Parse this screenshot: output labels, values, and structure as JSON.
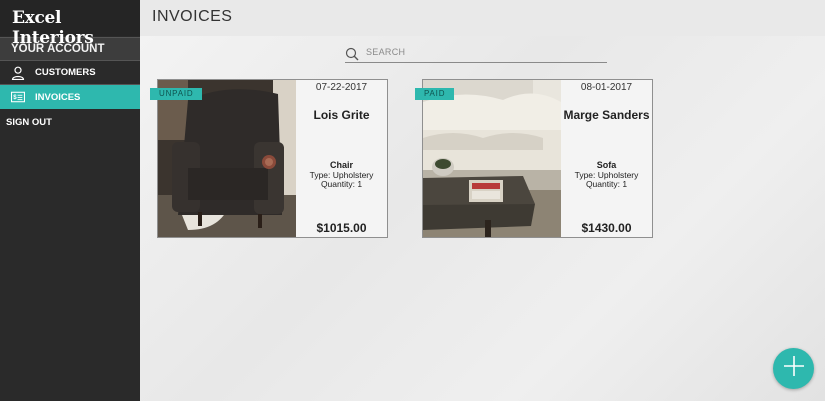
{
  "app": {
    "brand": "Excel Interiors"
  },
  "sidebar": {
    "header": "YOUR ACCOUNT",
    "items": [
      {
        "label": "CUSTOMERS",
        "icon": "user-icon",
        "active": false
      },
      {
        "label": "INVOICES",
        "icon": "invoice-icon",
        "active": true
      }
    ],
    "signout": "SIGN OUT"
  },
  "page": {
    "title": "INVOICES"
  },
  "search": {
    "placeholder": "SEARCH",
    "value": "",
    "icon": "search-icon"
  },
  "invoices": [
    {
      "status": "UNPAID",
      "date": "07-22-2017",
      "customer": "Lois Grite",
      "item": "Chair",
      "type": "Type: Upholstery",
      "quantity": "Quantity: 1",
      "price": "$1015.00",
      "photo": "armchair-photo"
    },
    {
      "status": "PAID",
      "date": "08-01-2017",
      "customer": "Marge Sanders",
      "item": "Sofa",
      "type": "Type: Upholstery",
      "quantity": "Quantity: 1",
      "price": "$1430.00",
      "photo": "sofa-photo"
    }
  ],
  "fab": {
    "icon": "plus-icon"
  },
  "colors": {
    "accent": "#2eb8ae",
    "sidebar": "#2a2a2a",
    "background": "#ededed"
  }
}
